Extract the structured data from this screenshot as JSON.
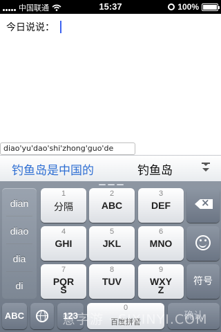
{
  "status_bar": {
    "carrier": "中国联通",
    "time": "15:37",
    "battery": "100%",
    "battery_level": 1.0,
    "icons": [
      "signal-dots-icon",
      "wifi-icon",
      "rotation-lock-icon",
      "battery-icon"
    ]
  },
  "editor": {
    "text": "今日说说："
  },
  "pinyin_preview": "diao'yu'dao'shi'zhong'guo'de",
  "candidates": {
    "items": [
      "钓鱼岛是中国的",
      "钓鱼岛"
    ],
    "expand_icon": "chevron-double-down-icon"
  },
  "pinyin_choices": [
    "dian",
    "diao",
    "dia",
    "di"
  ],
  "keys": {
    "row1": [
      {
        "num": "1",
        "label": "分隔"
      },
      {
        "num": "2",
        "label": "ABC"
      },
      {
        "num": "3",
        "label": "DEF"
      }
    ],
    "row2": [
      {
        "num": "4",
        "label": "GHI"
      },
      {
        "num": "5",
        "label": "JKL"
      },
      {
        "num": "6",
        "label": "MNO"
      }
    ],
    "row3": [
      {
        "num": "7",
        "label": "PQR",
        "label2": "S"
      },
      {
        "num": "8",
        "label": "TUV"
      },
      {
        "num": "9",
        "label": "WXY",
        "label2": "Z"
      }
    ],
    "zero_num": "0",
    "space_label": "百度拼音",
    "backspace_icon": "backspace-icon",
    "emoji_icon": "smiley-icon",
    "symbol_label": "符号",
    "abc_label": "ABC",
    "globe_icon": "globe-icon",
    "num_label": "123",
    "confirm_label": "确认"
  },
  "watermark": "意字游 · SIXINYI.COM",
  "colors": {
    "accent_candidate": "#2f6fd3",
    "caret": "#3c62f0",
    "keyboard_bg": "#7b8592"
  }
}
